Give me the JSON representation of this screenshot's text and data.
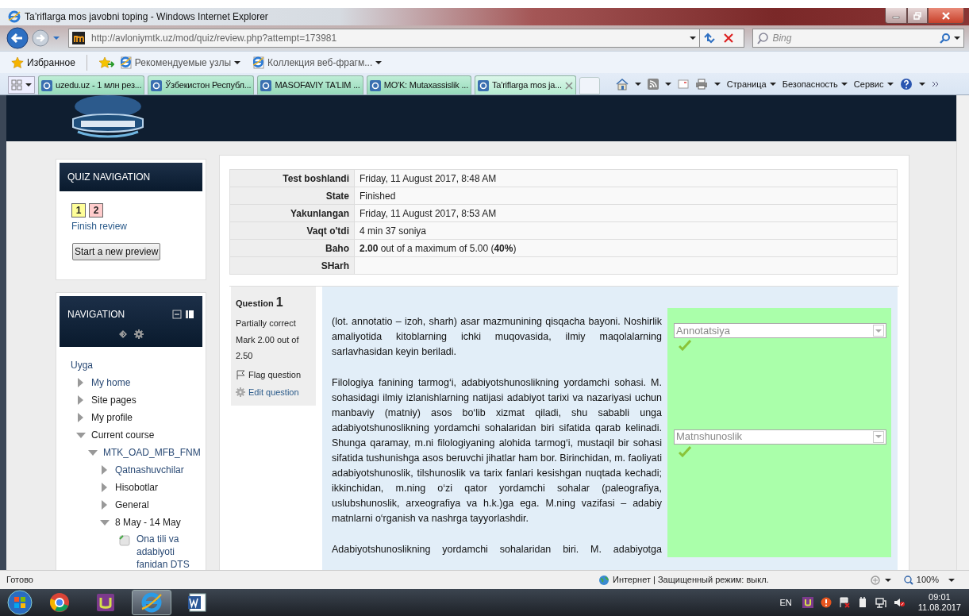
{
  "window": {
    "title": "Ta’riflarga mos javobni toping - Windows Internet Explorer"
  },
  "address_bar": {
    "url": "http://avloniymtk.uz/mod/quiz/review.php?attempt=173981"
  },
  "search_box": {
    "placeholder": "Bing"
  },
  "favorites_bar": {
    "label": "Избранное",
    "items": [
      "Рекомендуемые узлы",
      "Коллекция веб-фрагм..."
    ]
  },
  "tabs": [
    {
      "label": "uzedu.uz - 1 млн рез...",
      "selected": false
    },
    {
      "label": "Ўзбекистон Республ...",
      "selected": false
    },
    {
      "label": "MASOFAVIY TA'LIM ...",
      "selected": false
    },
    {
      "label": "MO'K: Mutaxassislik ...",
      "selected": false
    },
    {
      "label": "Ta'riflarga mos ja...",
      "selected": true
    }
  ],
  "command_bar": [
    "Страница",
    "Безопасность",
    "Сервис"
  ],
  "quiz_navigation": {
    "title": "QUIZ NAVIGATION",
    "questions": [
      {
        "label": "1",
        "color": "#ffff99"
      },
      {
        "label": "2",
        "color": "#ffcccc"
      }
    ],
    "finish_link": "Finish review",
    "start_button": "Start a new preview"
  },
  "navigation": {
    "title": "NAVIGATION",
    "items": [
      {
        "label": "Uyga",
        "kind": "home",
        "link": true
      },
      {
        "label": "My home",
        "kind": "branch",
        "link": true,
        "expanded": false
      },
      {
        "label": "Site pages",
        "kind": "branch",
        "link": false,
        "expanded": false
      },
      {
        "label": "My profile",
        "kind": "branch",
        "link": false,
        "expanded": false
      },
      {
        "label": "Current course",
        "kind": "branch",
        "link": false,
        "expanded": true,
        "children": [
          {
            "label": "MTK_OAD_MFB_FNM",
            "kind": "branch",
            "link": true,
            "expanded": true,
            "children": [
              {
                "label": "Qatnashuvchilar",
                "kind": "branch",
                "link": true,
                "expanded": false
              },
              {
                "label": "Hisobotlar",
                "kind": "branch",
                "link": false,
                "expanded": false
              },
              {
                "label": "General",
                "kind": "branch",
                "link": false,
                "expanded": false
              },
              {
                "label": "8 May - 14 May",
                "kind": "branch",
                "link": false,
                "expanded": true,
                "children": [
                  {
                    "label": "Ona tili va adabiyoti fanidan DTS",
                    "kind": "resource",
                    "link": true
                  }
                ]
              }
            ]
          }
        ]
      }
    ]
  },
  "summary": [
    {
      "label": "Test boshlandi",
      "value": "Friday, 11 August 2017, 8:48 AM"
    },
    {
      "label": "State",
      "value": "Finished"
    },
    {
      "label": "Yakunlangan",
      "value": "Friday, 11 August 2017, 8:53 AM"
    },
    {
      "label": "Vaqt o'tdi",
      "value": "4 min 37 soniya"
    },
    {
      "label": "Baho",
      "value": "**2.00** out of a maximum of 5.00 (**40%**)"
    },
    {
      "label": "SHarh"
    }
  ],
  "question": {
    "label": "Question",
    "number": "1",
    "status": "Partially correct",
    "mark": "Mark 2.00 out of 2.50",
    "flag": "Flag question",
    "edit": "Edit question",
    "matches": [
      {
        "text": "(lot. annotatio – izoh, sharh) asar mazmunining qisqacha bayoni. Noshirlik amaliyotida kitoblarning ichki muqovasida, ilmiy maqolalarning sarlavhasidan keyin beriladi.",
        "answer": "Annotatsiya",
        "correct": true
      },
      {
        "text": "Filologiya fanining tarmog‘i, adabiyotshunoslikning yordamchi sohasi. M. sohasidagi ilmiy izlanishlarning natijasi adabiyot tarixi va nazariyasi uchun manbaviy (matniy) asos bo‘lib xizmat qiladi, shu sababli unga adabiyotshunoslikning yordamchi sohalaridan biri sifatida qarab kelinadi. Shunga qaramay, m.ni filologiyaning alohida tarmog‘i, mustaqil bir sohasi sifatida tushunishga asos beruvchi jihatlar ham bor. Birinchidan, m. faoliyati adabiyotshunoslik, tilshunoslik va tarix fanlari kesishgan nuqtada kechadi; ikkinchidan, m.ning o‘zi qator yordamchi sohalar (paleografiya, uslubshunoslik, arxeografiya va h.k.)ga ega. M.ning vazifasi – adabiy matnlarni o‘rganish va nashrga tayyorlashdir.",
        "answer": "Matnshunoslik",
        "correct": true
      },
      {
        "text": "Adabiyotshunoslikning yordamchi sohalaridan biri. M. adabiyotga"
      }
    ]
  },
  "status_bar": {
    "text": "Готово",
    "zone": "Интернет | Защищенный режим: выкл.",
    "zoom": "100%"
  },
  "taskbar": {
    "language": "EN",
    "time": "09:01",
    "date": "11.08.2017"
  }
}
